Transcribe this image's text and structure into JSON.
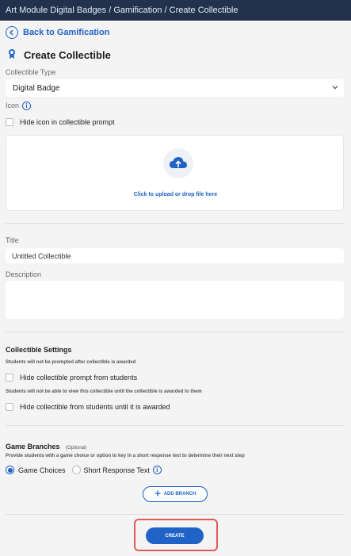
{
  "breadcrumb": "Art Module Digital Badges / Gamification / Create Collectible",
  "back_link": "Back to Gamification",
  "page_title": "Create Collectible",
  "collectible_type": {
    "label": "Collectible Type",
    "value": "Digital Badge"
  },
  "icon": {
    "label": "Icon",
    "hide_label": "Hide icon in collectible prompt",
    "upload_text": "Click to upload or drop file here"
  },
  "title_field": {
    "label": "Title",
    "value": "Untitled Collectible"
  },
  "description_field": {
    "label": "Description",
    "value": ""
  },
  "settings": {
    "heading": "Collectible Settings",
    "note_prompt": "Students will not be prompted after collectible is awarded",
    "hide_prompt_label": "Hide collectible prompt from students",
    "note_view": "Students will not be able to view this collectible until the collectible is awarded to them",
    "hide_collectible_label": "Hide collectible from students until it is awarded"
  },
  "branches": {
    "heading": "Game Branches",
    "optional": "(Optional)",
    "note": "Provide students with a game choice or option to key in a short response text to determine their next step",
    "option_choices": "Game Choices",
    "option_short": "Short Response Text",
    "selected": "Game Choices",
    "add_label": "ADD BRANCH"
  },
  "create_label": "CREATE",
  "colors": {
    "header_bg": "#22324d",
    "accent": "#1f63c6",
    "highlight_ring": "#e05a5a"
  }
}
